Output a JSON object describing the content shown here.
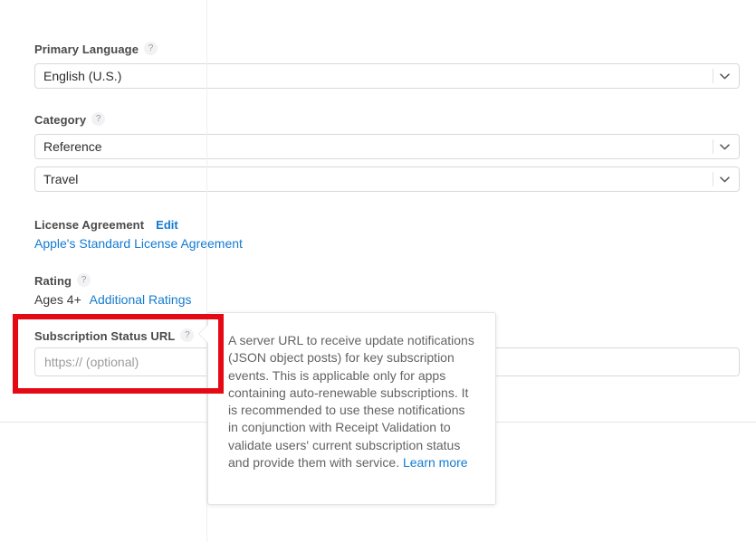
{
  "form": {
    "primary_language": {
      "label": "Primary Language",
      "help_icon": "?",
      "value": "English (U.S.)"
    },
    "category": {
      "label": "Category",
      "help_icon": "?",
      "primary_value": "Reference",
      "secondary_value": "Travel"
    },
    "license_agreement": {
      "label": "License Agreement",
      "edit_label": "Edit",
      "agreement_link": "Apple's Standard License Agreement"
    },
    "rating": {
      "label": "Rating",
      "help_icon": "?",
      "value": "Ages 4+",
      "additional_link": "Additional Ratings"
    },
    "subscription_status_url": {
      "label": "Subscription Status URL",
      "help_icon": "?",
      "value": "",
      "placeholder": "https:// (optional)"
    }
  },
  "tooltip": {
    "text": "A server URL to receive update notifications (JSON object posts) for key subscription events. This is applicable only for apps containing auto-renewable subscriptions. It is recommended to use these notifications in conjunction with Receipt Validation to validate users' current subscription status and provide them with service. ",
    "learn_more": "Learn more"
  },
  "colors": {
    "link": "#147bd1",
    "highlight": "#e50914",
    "label": "#4a4a4a",
    "placeholder": "#9b9b9b"
  }
}
